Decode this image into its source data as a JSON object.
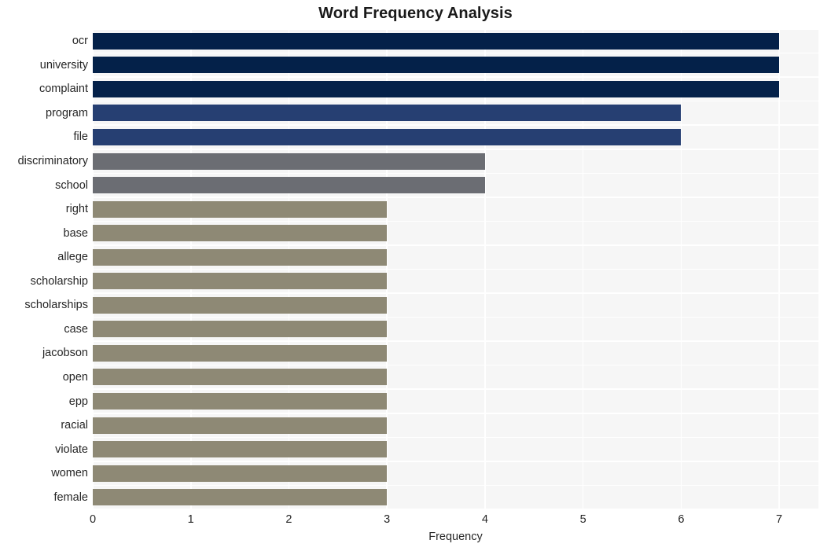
{
  "chart_data": {
    "type": "bar",
    "orientation": "horizontal",
    "title": "Word Frequency Analysis",
    "xlabel": "Frequency",
    "ylabel": "",
    "xlim": [
      0,
      7.4
    ],
    "xticks": [
      "0",
      "1",
      "2",
      "3",
      "4",
      "5",
      "6",
      "7"
    ],
    "xtick_values": [
      0,
      1,
      2,
      3,
      4,
      5,
      6,
      7
    ],
    "grid": true,
    "grid_color": "#ffffff",
    "plot_background": "#f6f6f6",
    "page_background": "#ffffff",
    "legend": null,
    "categories": [
      "ocr",
      "university",
      "complaint",
      "program",
      "file",
      "discriminatory",
      "school",
      "right",
      "base",
      "allege",
      "scholarship",
      "scholarships",
      "case",
      "jacobson",
      "open",
      "epp",
      "racial",
      "violate",
      "women",
      "female"
    ],
    "values": [
      7,
      7,
      7,
      6,
      6,
      4,
      4,
      3,
      3,
      3,
      3,
      3,
      3,
      3,
      3,
      3,
      3,
      3,
      3,
      3
    ],
    "bar_colors": [
      "#042149",
      "#042149",
      "#042149",
      "#263f72",
      "#263f72",
      "#6b6d73",
      "#6b6d73",
      "#8e8975",
      "#8e8975",
      "#8e8975",
      "#8e8975",
      "#8e8975",
      "#8e8975",
      "#8e8975",
      "#8e8975",
      "#8e8975",
      "#8e8975",
      "#8e8975",
      "#8e8975",
      "#8e8975"
    ],
    "palette": {
      "freq_7": "#042149",
      "freq_6": "#263f72",
      "freq_4": "#6b6d73",
      "freq_3": "#8e8975"
    }
  }
}
